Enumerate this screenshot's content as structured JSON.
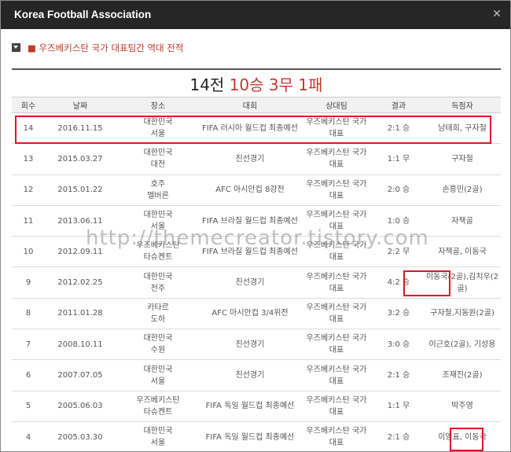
{
  "window": {
    "title": "Korea Football Association",
    "close_icon": "close-icon"
  },
  "section": {
    "title": "■ 우즈베키스탄 국가 대표팀간 역대 전적",
    "icon": "collapse-icon"
  },
  "record": {
    "total": "14전",
    "wins": "10승",
    "draws": "3무",
    "losses": "1패"
  },
  "table": {
    "headers": [
      "회수",
      "날짜",
      "장소",
      "대회",
      "상대팀",
      "결과",
      "득점자"
    ],
    "rows": [
      {
        "no": "14",
        "date": "2016.11.15",
        "venue1": "대한민국",
        "venue2": "서울",
        "comp": "FIFA 러시아 월드컵 최종예선",
        "opp1": "우즈베키스탄 국가",
        "opp2": "대표",
        "result": "2:1 승",
        "scorer": "남태희, 구자철"
      },
      {
        "no": "13",
        "date": "2015.03.27",
        "venue1": "대한민국",
        "venue2": "대전",
        "comp": "친선경기",
        "opp1": "우즈베키스탄 국가",
        "opp2": "대표",
        "result": "1:1 무",
        "scorer": "구자철"
      },
      {
        "no": "12",
        "date": "2015.01.22",
        "venue1": "호주",
        "venue2": "멜버른",
        "comp": "AFC 아시안컵 8강전",
        "opp1": "우즈베키스탄 국가",
        "opp2": "대표",
        "result": "2:0 승",
        "scorer": "손흥민(2골)"
      },
      {
        "no": "11",
        "date": "2013.06.11",
        "venue1": "대한민국",
        "venue2": "서울",
        "comp": "FIFA 브라질 월드컵 최종예선",
        "opp1": "우즈베키스탄 국가",
        "opp2": "대표",
        "result": "1:0 승",
        "scorer": "자책골"
      },
      {
        "no": "10",
        "date": "2012.09.11",
        "venue1": "우즈베키스탄",
        "venue2": "타슈켄트",
        "comp": "FIFA 브라질 월드컵 최종예선",
        "opp1": "우즈베키스탄 국가",
        "opp2": "대표",
        "result": "2:2 무",
        "scorer": "자책골, 이동국"
      },
      {
        "no": "9",
        "date": "2012.02.25",
        "venue1": "대한민국",
        "venue2": "전주",
        "comp": "친선경기",
        "opp1": "우즈베키스탄 국가",
        "opp2": "대표",
        "result": "4:2 승",
        "scorer": "이동국(2골),김치우(2골)"
      },
      {
        "no": "8",
        "date": "2011.01.28",
        "venue1": "카타르",
        "venue2": "도하",
        "comp": "AFC 아시안컵 3/4위전",
        "opp1": "우즈베키스탄 국가",
        "opp2": "대표",
        "result": "3:2 승",
        "scorer": "구자철,지동원(2골)"
      },
      {
        "no": "7",
        "date": "2008.10.11",
        "venue1": "대한민국",
        "venue2": "수원",
        "comp": "친선경기",
        "opp1": "우즈베키스탄 국가",
        "opp2": "대표",
        "result": "3:0 승",
        "scorer": "이근호(2골), 기성용"
      },
      {
        "no": "6",
        "date": "2007.07.05",
        "venue1": "대한민국",
        "venue2": "서울",
        "comp": "친선경기",
        "opp1": "우즈베키스탄 국가",
        "opp2": "대표",
        "result": "2:1 승",
        "scorer": "조재진(2골)"
      },
      {
        "no": "5",
        "date": "2005.06.03",
        "venue1": "우즈베키스탄",
        "venue2": "타슈켄트",
        "comp": "FIFA 독일 월드컵 최종예선",
        "opp1": "우즈베키스탄 국가",
        "opp2": "대표",
        "result": "1:1 무",
        "scorer": "박주영"
      },
      {
        "no": "4",
        "date": "2005.03.30",
        "venue1": "대한민국",
        "venue2": "서울",
        "comp": "FIFA 독일 월드컵 최종예선",
        "opp1": "우즈베키스탄 국가",
        "opp2": "대표",
        "result": "2:1 승",
        "scorer": "이영표, 이동국"
      }
    ]
  },
  "watermark": "http://themecreator.tistory.com"
}
